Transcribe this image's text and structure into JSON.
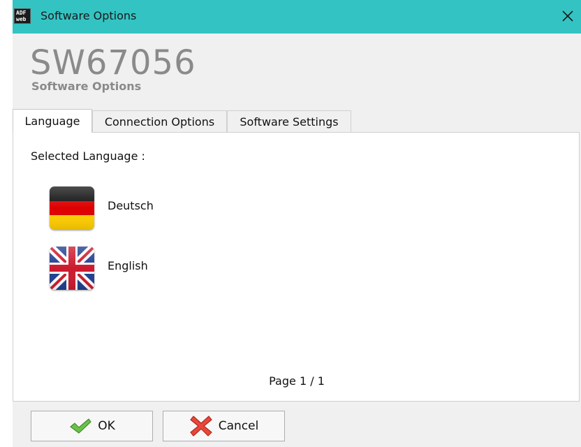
{
  "window": {
    "title": "Software Options",
    "app_icon_line1": "ADF",
    "app_icon_line2": "web"
  },
  "header": {
    "product_code": "SW67056",
    "subtitle": "Software Options"
  },
  "tabs": [
    {
      "label": "Language",
      "active": true
    },
    {
      "label": "Connection Options",
      "active": false
    },
    {
      "label": "Software Settings",
      "active": false
    }
  ],
  "language_panel": {
    "selected_label": "Selected Language :",
    "languages": [
      {
        "label": "Deutsch",
        "icon": "germany-flag-icon"
      },
      {
        "label": "English",
        "icon": "uk-flag-icon"
      }
    ],
    "page_info": "Page 1 / 1"
  },
  "footer": {
    "ok_label": "OK",
    "cancel_label": "Cancel"
  },
  "colors": {
    "titlebar": "#34c3c3",
    "panel_bg": "#ffffff",
    "window_bg": "#f0f0f0"
  }
}
